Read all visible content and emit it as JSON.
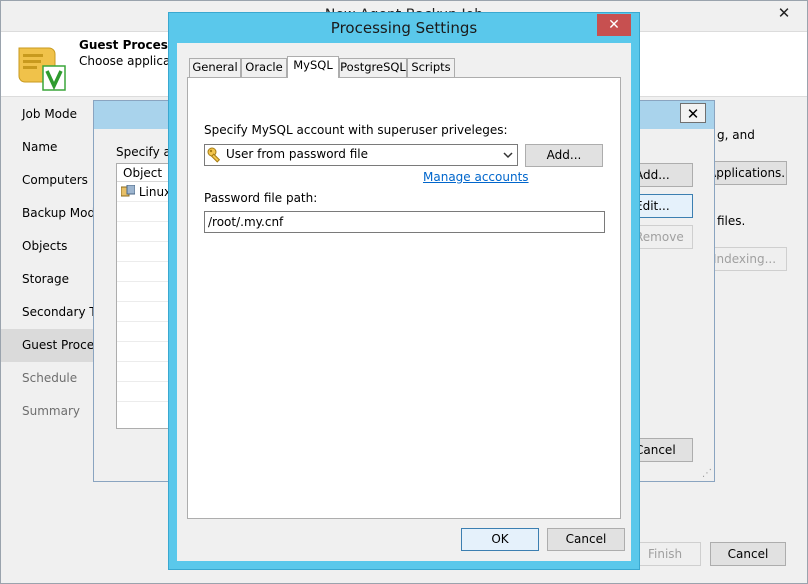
{
  "main_window": {
    "title": "New Agent Backup Job",
    "header_title": "Guest Processing",
    "header_subtitle": "Choose application processing options.",
    "header_icon": "scroll-with-checkmark-icon",
    "nav": [
      {
        "label": "Job Mode",
        "state": "normal"
      },
      {
        "label": "Name",
        "state": "normal"
      },
      {
        "label": "Computers",
        "state": "normal"
      },
      {
        "label": "Backup Mode",
        "state": "normal"
      },
      {
        "label": "Objects",
        "state": "normal"
      },
      {
        "label": "Storage",
        "state": "normal"
      },
      {
        "label": "Secondary Target",
        "state": "normal"
      },
      {
        "label": "Guest Processing",
        "state": "active"
      },
      {
        "label": "Schedule",
        "state": "disabled"
      },
      {
        "label": "Summary",
        "state": "disabled"
      }
    ],
    "right_text_1": "g, and",
    "right_text_2": "files.",
    "applications_button": "Applications...",
    "indexing_button": "Indexing...",
    "finish_button": "Finish",
    "cancel_button": "Cancel"
  },
  "mid_dialog": {
    "specify_label": "Specify application processing settings for each object",
    "column_object": "Object",
    "row_linux": "Linux",
    "add_button": "Add...",
    "edit_button": "Edit...",
    "remove_button": "Remove",
    "cancel_button": "Cancel"
  },
  "processing_settings": {
    "title": "Processing Settings",
    "tabs": [
      {
        "label": "General",
        "active": false
      },
      {
        "label": "Oracle",
        "active": false
      },
      {
        "label": "MySQL",
        "active": true
      },
      {
        "label": "PostgreSQL",
        "active": false
      },
      {
        "label": "Scripts",
        "active": false
      }
    ],
    "account_label": "Specify MySQL account with superuser priveleges:",
    "account_value": "User from password file",
    "add_button": "Add...",
    "manage_link": "Manage accounts",
    "password_path_label": "Password file path:",
    "password_path_value": "/root/.my.cnf",
    "ok_button": "OK",
    "cancel_button": "Cancel",
    "close_glyph": "✕"
  },
  "colors": {
    "dialog_border": "#5ac8eb",
    "close_button": "#c75050",
    "link": "#0066cc",
    "default_button_border": "#3c7fb1"
  }
}
